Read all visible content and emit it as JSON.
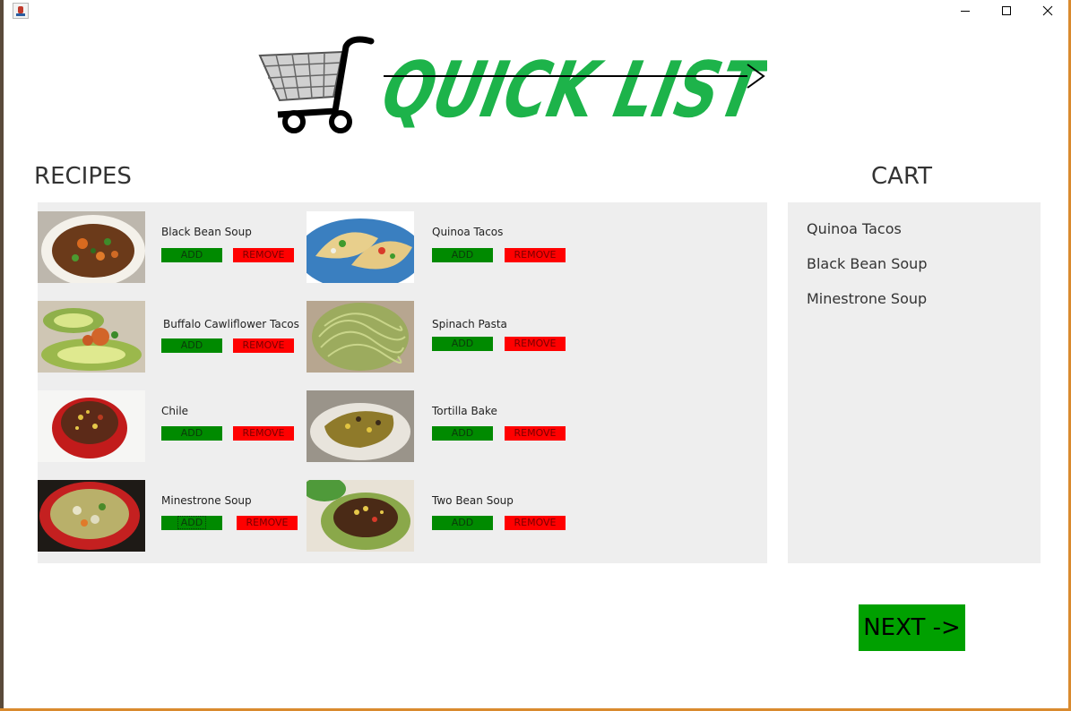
{
  "window": {
    "icon": "java-app-icon",
    "controls": [
      "minimize-icon",
      "maximize-icon",
      "close-icon"
    ]
  },
  "logo": {
    "text": "QUICK LIST",
    "icon": "shopping-cart-icon",
    "color": "#1db34a"
  },
  "recipes": {
    "title": "RECIPES",
    "add_label": "ADD",
    "remove_label": "REMOVE",
    "items": [
      {
        "name": "Black Bean Soup",
        "image": "black-bean-soup-image"
      },
      {
        "name": "Quinoa Tacos",
        "image": "quinoa-tacos-image"
      },
      {
        "name": "Buffalo Cawliflower Tacos",
        "image": "buffalo-cauliflower-tacos-image"
      },
      {
        "name": "Spinach Pasta",
        "image": "spinach-pasta-image"
      },
      {
        "name": "Chile",
        "image": "chile-image"
      },
      {
        "name": "Tortilla Bake",
        "image": "tortilla-bake-image"
      },
      {
        "name": "Minestrone Soup",
        "image": "minestrone-soup-image"
      },
      {
        "name": "Two Bean Soup",
        "image": "two-bean-soup-image"
      }
    ]
  },
  "cart": {
    "title": "CART",
    "items": [
      "Quinoa Tacos",
      "Black Bean Soup",
      "Minestrone Soup"
    ]
  },
  "next_button": {
    "label": "NEXT ->"
  },
  "colors": {
    "add": "#008a00",
    "remove": "#ff0000",
    "next": "#00a000",
    "panel": "#eeeeee"
  }
}
